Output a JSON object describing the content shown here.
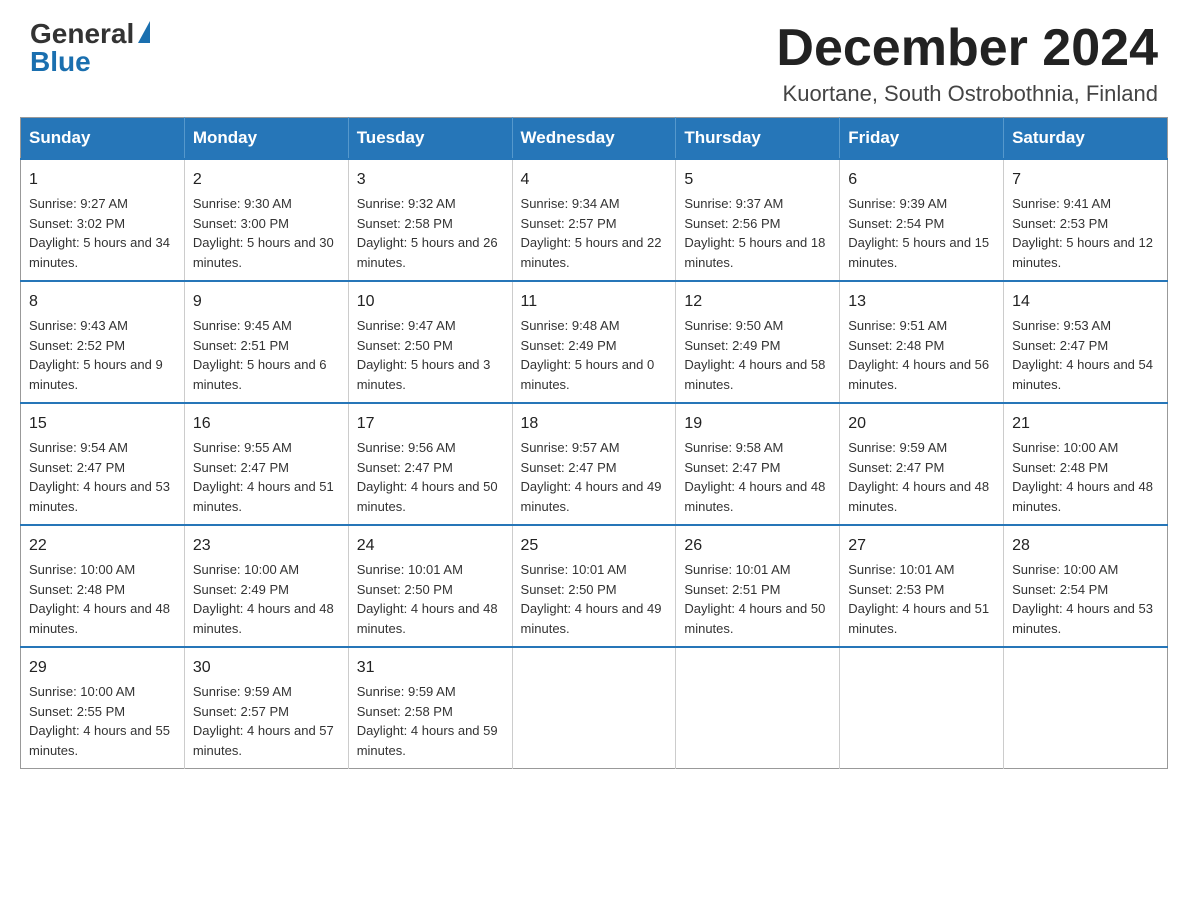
{
  "header": {
    "logo_general": "General",
    "logo_blue": "Blue",
    "month_title": "December 2024",
    "location": "Kuortane, South Ostrobothnia, Finland"
  },
  "weekdays": [
    "Sunday",
    "Monday",
    "Tuesday",
    "Wednesday",
    "Thursday",
    "Friday",
    "Saturday"
  ],
  "weeks": [
    [
      {
        "day": "1",
        "sunrise": "9:27 AM",
        "sunset": "3:02 PM",
        "daylight": "5 hours and 34 minutes."
      },
      {
        "day": "2",
        "sunrise": "9:30 AM",
        "sunset": "3:00 PM",
        "daylight": "5 hours and 30 minutes."
      },
      {
        "day": "3",
        "sunrise": "9:32 AM",
        "sunset": "2:58 PM",
        "daylight": "5 hours and 26 minutes."
      },
      {
        "day": "4",
        "sunrise": "9:34 AM",
        "sunset": "2:57 PM",
        "daylight": "5 hours and 22 minutes."
      },
      {
        "day": "5",
        "sunrise": "9:37 AM",
        "sunset": "2:56 PM",
        "daylight": "5 hours and 18 minutes."
      },
      {
        "day": "6",
        "sunrise": "9:39 AM",
        "sunset": "2:54 PM",
        "daylight": "5 hours and 15 minutes."
      },
      {
        "day": "7",
        "sunrise": "9:41 AM",
        "sunset": "2:53 PM",
        "daylight": "5 hours and 12 minutes."
      }
    ],
    [
      {
        "day": "8",
        "sunrise": "9:43 AM",
        "sunset": "2:52 PM",
        "daylight": "5 hours and 9 minutes."
      },
      {
        "day": "9",
        "sunrise": "9:45 AM",
        "sunset": "2:51 PM",
        "daylight": "5 hours and 6 minutes."
      },
      {
        "day": "10",
        "sunrise": "9:47 AM",
        "sunset": "2:50 PM",
        "daylight": "5 hours and 3 minutes."
      },
      {
        "day": "11",
        "sunrise": "9:48 AM",
        "sunset": "2:49 PM",
        "daylight": "5 hours and 0 minutes."
      },
      {
        "day": "12",
        "sunrise": "9:50 AM",
        "sunset": "2:49 PM",
        "daylight": "4 hours and 58 minutes."
      },
      {
        "day": "13",
        "sunrise": "9:51 AM",
        "sunset": "2:48 PM",
        "daylight": "4 hours and 56 minutes."
      },
      {
        "day": "14",
        "sunrise": "9:53 AM",
        "sunset": "2:47 PM",
        "daylight": "4 hours and 54 minutes."
      }
    ],
    [
      {
        "day": "15",
        "sunrise": "9:54 AM",
        "sunset": "2:47 PM",
        "daylight": "4 hours and 53 minutes."
      },
      {
        "day": "16",
        "sunrise": "9:55 AM",
        "sunset": "2:47 PM",
        "daylight": "4 hours and 51 minutes."
      },
      {
        "day": "17",
        "sunrise": "9:56 AM",
        "sunset": "2:47 PM",
        "daylight": "4 hours and 50 minutes."
      },
      {
        "day": "18",
        "sunrise": "9:57 AM",
        "sunset": "2:47 PM",
        "daylight": "4 hours and 49 minutes."
      },
      {
        "day": "19",
        "sunrise": "9:58 AM",
        "sunset": "2:47 PM",
        "daylight": "4 hours and 48 minutes."
      },
      {
        "day": "20",
        "sunrise": "9:59 AM",
        "sunset": "2:47 PM",
        "daylight": "4 hours and 48 minutes."
      },
      {
        "day": "21",
        "sunrise": "10:00 AM",
        "sunset": "2:48 PM",
        "daylight": "4 hours and 48 minutes."
      }
    ],
    [
      {
        "day": "22",
        "sunrise": "10:00 AM",
        "sunset": "2:48 PM",
        "daylight": "4 hours and 48 minutes."
      },
      {
        "day": "23",
        "sunrise": "10:00 AM",
        "sunset": "2:49 PM",
        "daylight": "4 hours and 48 minutes."
      },
      {
        "day": "24",
        "sunrise": "10:01 AM",
        "sunset": "2:50 PM",
        "daylight": "4 hours and 48 minutes."
      },
      {
        "day": "25",
        "sunrise": "10:01 AM",
        "sunset": "2:50 PM",
        "daylight": "4 hours and 49 minutes."
      },
      {
        "day": "26",
        "sunrise": "10:01 AM",
        "sunset": "2:51 PM",
        "daylight": "4 hours and 50 minutes."
      },
      {
        "day": "27",
        "sunrise": "10:01 AM",
        "sunset": "2:53 PM",
        "daylight": "4 hours and 51 minutes."
      },
      {
        "day": "28",
        "sunrise": "10:00 AM",
        "sunset": "2:54 PM",
        "daylight": "4 hours and 53 minutes."
      }
    ],
    [
      {
        "day": "29",
        "sunrise": "10:00 AM",
        "sunset": "2:55 PM",
        "daylight": "4 hours and 55 minutes."
      },
      {
        "day": "30",
        "sunrise": "9:59 AM",
        "sunset": "2:57 PM",
        "daylight": "4 hours and 57 minutes."
      },
      {
        "day": "31",
        "sunrise": "9:59 AM",
        "sunset": "2:58 PM",
        "daylight": "4 hours and 59 minutes."
      },
      null,
      null,
      null,
      null
    ]
  ]
}
